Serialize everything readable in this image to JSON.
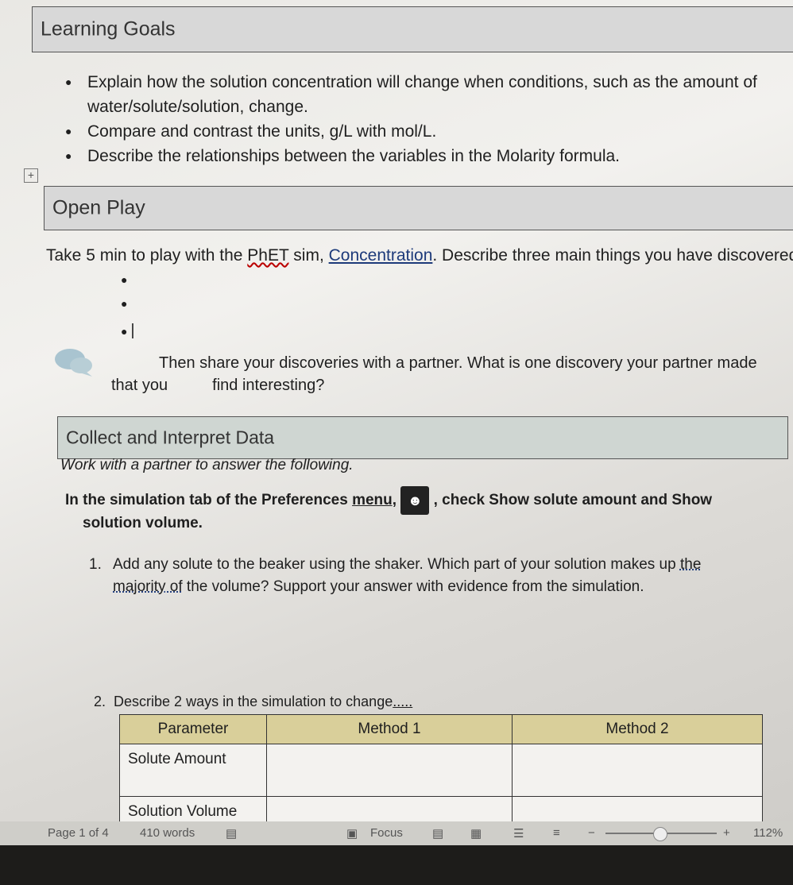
{
  "learning_goals": {
    "heading": "Learning Goals",
    "items": [
      "Explain how the solution concentration will change when conditions, such as the amount of",
      "water/solute/solution, change.",
      "Compare and contrast the units, g/L with mol/L.",
      "Describe the relationships between the variables in the Molarity formula."
    ]
  },
  "open_play": {
    "heading": "Open Play",
    "prompt_prefix": "Take 5 min to play with the ",
    "phet": "PhET",
    "prompt_mid": " sim, ",
    "sim_link": "Concentration",
    "prompt_suffix": ". Describe three main things you have discovered:",
    "share_line1": "Then share your discoveries with a partner. What is one discovery your partner made",
    "share_line2a": "that you",
    "share_line2b": "find interesting?"
  },
  "collect": {
    "heading": "Collect and Interpret Data",
    "instruction": "Work with a partner to answer the following.",
    "pref_line1a": "In the simulation tab of the Preferences ",
    "pref_menu": "menu,",
    "pref_line1b": ", check Show solute amount and Show",
    "pref_line2": "solution volume.",
    "q1_num": "1.",
    "q1_line1a": "Add any solute to the beaker using the shaker. Which part of your solution makes up ",
    "q1_the": "the",
    "q1_majority": "majority of",
    "q1_line2": " the volume? Support your answer with evidence from the simulation.",
    "q2_num": "2.",
    "q2_text": "Describe 2 ways in the simulation to change",
    "q2_trail": "....."
  },
  "table": {
    "headers": [
      "Parameter",
      "Method 1",
      "Method 2"
    ],
    "rows": [
      [
        "Solute Amount",
        "",
        ""
      ],
      [
        "Solution Volume",
        "",
        ""
      ]
    ]
  },
  "status_bar": {
    "page": "Page 1 of 4",
    "words": "410 words",
    "focus": "Focus",
    "zoom_minus": "−",
    "zoom_plus": "+",
    "zoom": "112%"
  }
}
